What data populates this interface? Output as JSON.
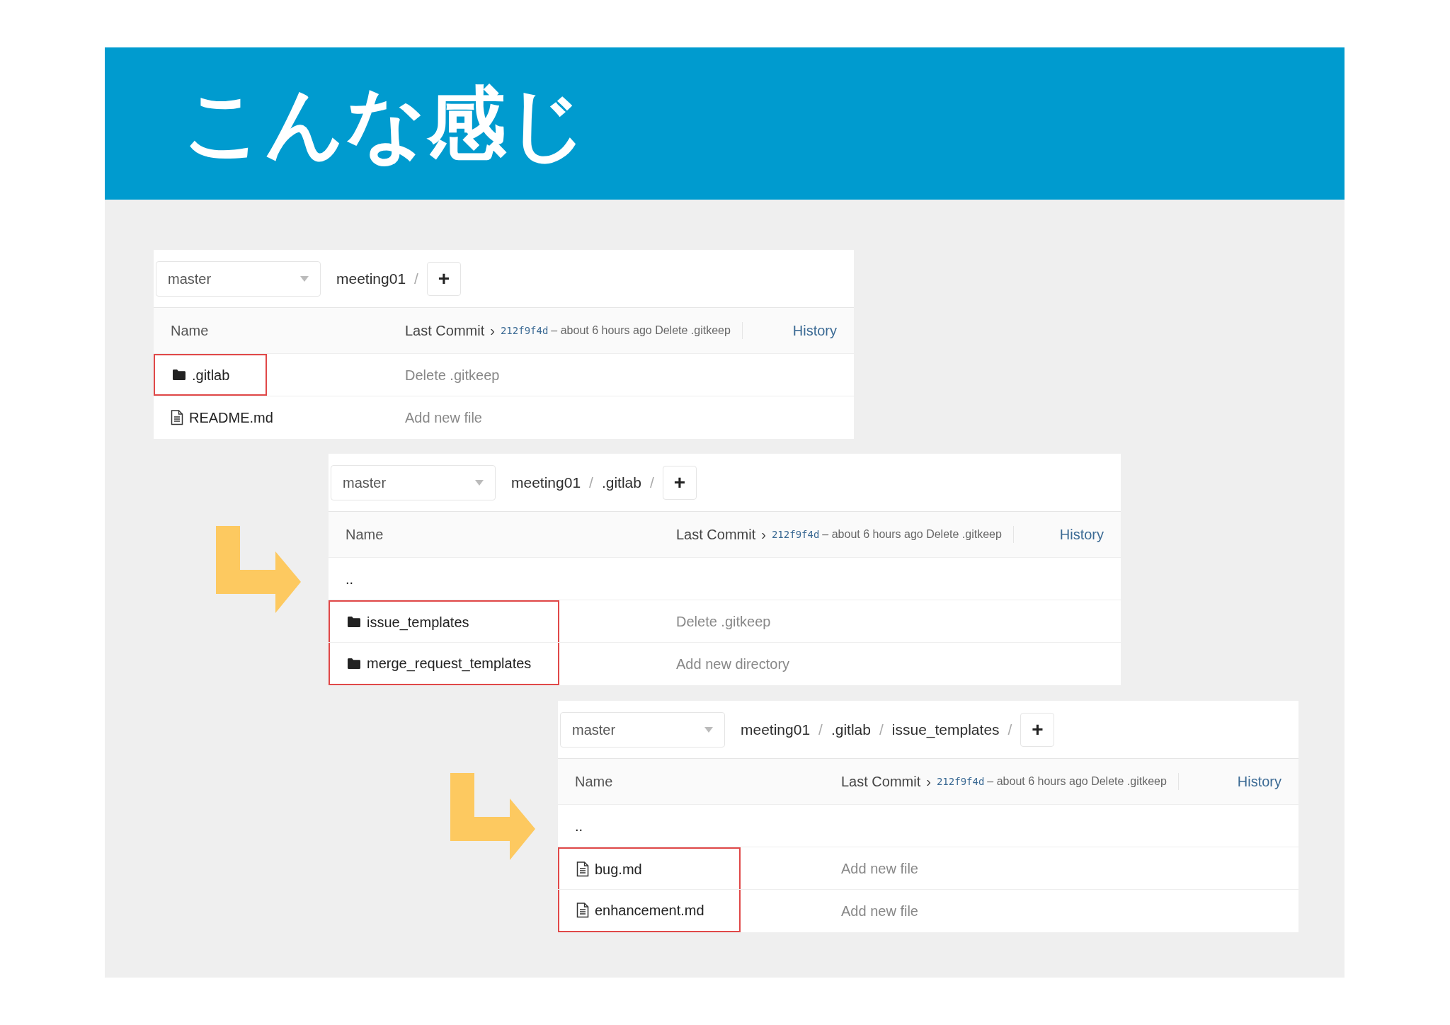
{
  "title": "こんな感じ",
  "panels": [
    {
      "branch": "master",
      "breadcrumbs": [
        {
          "label": "meeting01",
          "separator": "/"
        }
      ],
      "add": "+",
      "header": {
        "name": "Name",
        "last_commit": "Last Commit",
        "chevron": "›",
        "hash": "212f9f4d",
        "info": "– about 6 hours ago Delete .gitkeep",
        "history": "History"
      },
      "rows": [
        {
          "kind": "folder",
          "name": ".gitlab",
          "message": "Delete .gitkeep",
          "highlighted": true
        },
        {
          "kind": "file",
          "name": "README.md",
          "message": "Add new file",
          "highlighted": false
        }
      ]
    },
    {
      "branch": "master",
      "breadcrumbs": [
        {
          "label": "meeting01",
          "separator": "/"
        },
        {
          "label": ".gitlab",
          "separator": "/"
        }
      ],
      "add": "+",
      "header": {
        "name": "Name",
        "last_commit": "Last Commit",
        "chevron": "›",
        "hash": "212f9f4d",
        "info": "– about 6 hours ago Delete .gitkeep",
        "history": "History"
      },
      "rows": [
        {
          "kind": "parent",
          "name": "..",
          "highlighted": false
        },
        {
          "kind": "folder",
          "name": "issue_templates",
          "message": "Delete .gitkeep",
          "highlighted": true
        },
        {
          "kind": "folder",
          "name": "merge_request_templates",
          "message": "Add new directory",
          "highlighted": true
        }
      ]
    },
    {
      "branch": "master",
      "breadcrumbs": [
        {
          "label": "meeting01",
          "separator": "/"
        },
        {
          "label": ".gitlab",
          "separator": "/"
        },
        {
          "label": "issue_templates",
          "separator": "/"
        }
      ],
      "add": "+",
      "header": {
        "name": "Name",
        "last_commit": "Last Commit",
        "chevron": "›",
        "hash": "212f9f4d",
        "info": "– about 6 hours ago Delete .gitkeep",
        "history": "History"
      },
      "rows": [
        {
          "kind": "parent",
          "name": "..",
          "highlighted": false
        },
        {
          "kind": "file",
          "name": "bug.md",
          "message": "Add new file",
          "highlighted": true
        },
        {
          "kind": "file",
          "name": "enhancement.md",
          "message": "Add new file",
          "highlighted": true
        }
      ]
    }
  ]
}
